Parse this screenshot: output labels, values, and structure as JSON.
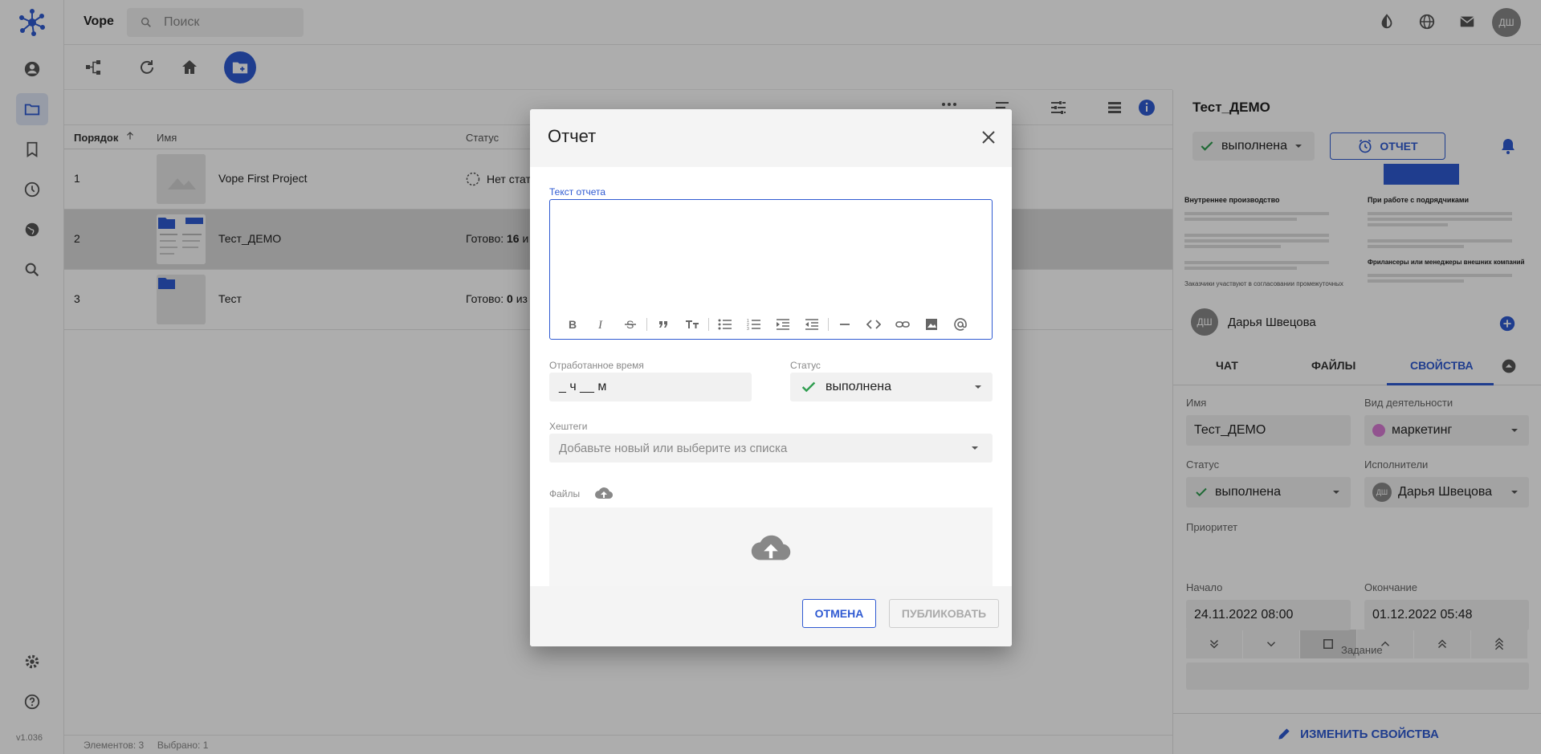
{
  "app": {
    "brand": "Vope",
    "version": "v1.036"
  },
  "search": {
    "placeholder": "Поиск"
  },
  "table": {
    "headers": {
      "order": "Порядок",
      "name": "Имя",
      "status": "Статус"
    },
    "rows": [
      {
        "num": "1",
        "name": "Vope First Project",
        "status": "Нет стат"
      },
      {
        "num": "2",
        "name": "Тест_ДЕМО",
        "status_prefix": "Готово: ",
        "status_value": "16",
        "status_suffix": " и"
      },
      {
        "num": "3",
        "name": "Тест",
        "status_prefix": "Готово: ",
        "status_value": "0",
        "status_suffix": " из"
      }
    ]
  },
  "footer": {
    "text": "Элементов: 3     Выбрано: 1"
  },
  "panel": {
    "title": "Тест_ДЕМО",
    "status": "выполнена",
    "report_button": "ОТЧЕТ",
    "preview": {
      "left_heading": "Внутреннее производство",
      "right_heading": "При работе с подрядчиками",
      "left_bottom": "Заказчики участвуют в согласовании промежуточных",
      "right_bottom": "Фрилансеры или менеджеры внешних компаний"
    },
    "assignee_initials": "ДШ",
    "assignee_name": "Дарья Швецова",
    "tabs": [
      "ЧАТ",
      "ФАЙЛЫ",
      "СВОЙСТВА"
    ],
    "fields": {
      "name_label": "Имя",
      "name_value": "Тест_ДЕМО",
      "activity_label": "Вид деятельности",
      "activity_value": "маркетинг",
      "status_label": "Статус",
      "status_value": "выполнена",
      "executors_label": "Исполнители",
      "executors_value": "Дарья Швецова",
      "priority_label": "Приоритет",
      "start_label": "Начало",
      "start_value": "24.11.2022 08:00",
      "end_label": "Окончание",
      "end_value": "01.12.2022 05:48",
      "task_label": "Задание"
    },
    "change_button": "ИЗМЕНИТЬ СВОЙСТВА"
  },
  "user": {
    "initials": "ДШ"
  },
  "modal": {
    "title": "Отчет",
    "report_text_label": "Текст отчета",
    "report_text_value": "",
    "time_label": "Отработанное время",
    "time_value": "_ ч __ м",
    "status_label": "Статус",
    "status_value": "выполнена",
    "hashtags_label": "Хештеги",
    "hashtags_placeholder": "Добавьте новый или выберите из списка",
    "files_label": "Файлы",
    "cancel": "ОТМЕНА",
    "publish": "ПУБЛИКОВАТЬ"
  },
  "colors": {
    "accent": "#2f5ad2",
    "success": "#2e9d4f",
    "activity_dot": "#d77bd3"
  }
}
